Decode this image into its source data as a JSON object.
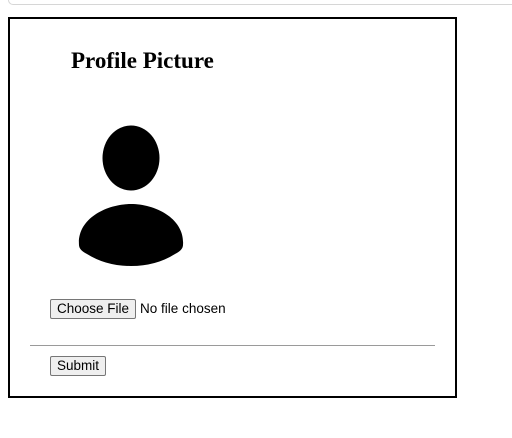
{
  "form": {
    "title": "Profile Picture",
    "avatar_icon": "user-silhouette-icon",
    "file_input": {
      "button_label": "Choose File",
      "status_text": "No file chosen"
    },
    "submit_label": "Submit"
  },
  "colors": {
    "border": "#000000",
    "divider": "#9a9a9a",
    "button_bg": "#efefef",
    "button_border": "#767676",
    "avatar_fill": "#000000"
  }
}
